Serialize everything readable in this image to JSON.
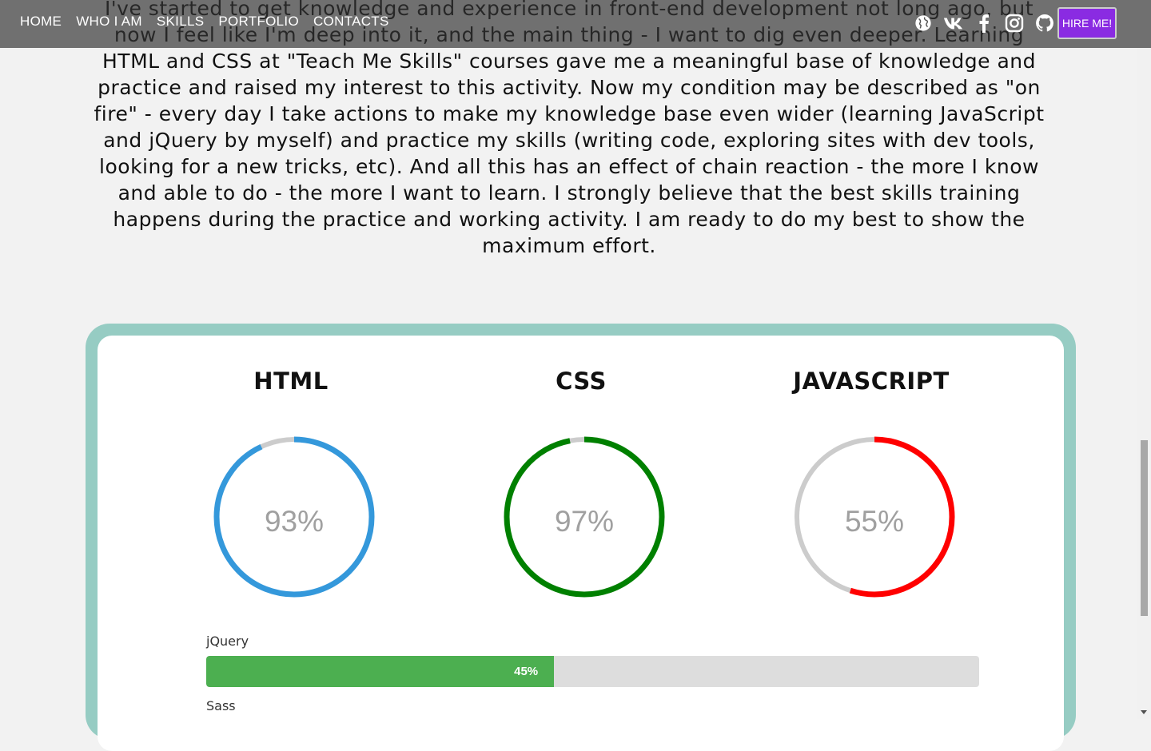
{
  "nav": {
    "links": [
      "HOME",
      "WHO I AM",
      "SKILLS",
      "PORTFOLIO",
      "CONTACTS"
    ],
    "socials": [
      "globe-icon",
      "vk-icon",
      "facebook-icon",
      "instagram-icon",
      "github-icon"
    ],
    "hire_label": "HIRE ME!",
    "hire_color": "#8a2be2"
  },
  "intro": {
    "text": "I've started to get knowledge and experience in front-end development not long ago, but now I feel like I'm deep into it, and the main thing - I want to dig even deeper. Learning HTML and CSS at \"Teach Me Skills\" courses gave me a meaningful base of knowledge and practice and raised my interest to this activity. Now my condition may be described as \"on fire\" - every day I take actions to make my knowledge base even wider (learning JavaScript and jQuery by myself) and practice my skills (writing code, exploring sites with dev tools, looking for a new tricks, etc). And all this has an effect of chain reaction - the more I know and able to do - the more I want to learn. I strongly believe that the best skills training happens during the practice and working activity. I am ready to do my best to show the maximum effort."
  },
  "skills": {
    "circles": [
      {
        "title": "HTML",
        "percent": 93,
        "label": "93%",
        "color": "#3498db"
      },
      {
        "title": "CSS",
        "percent": 97,
        "label": "97%",
        "color": "#008000"
      },
      {
        "title": "JAVASCRIPT",
        "percent": 55,
        "label": "55%",
        "color": "#ff0000"
      }
    ],
    "bars": [
      {
        "name": "jQuery",
        "percent": 45,
        "label": "45%",
        "color": "#4caf50"
      },
      {
        "name": "Sass"
      }
    ],
    "ring_track_color": "#cccccc",
    "card_border_color": "#96ccc3"
  }
}
